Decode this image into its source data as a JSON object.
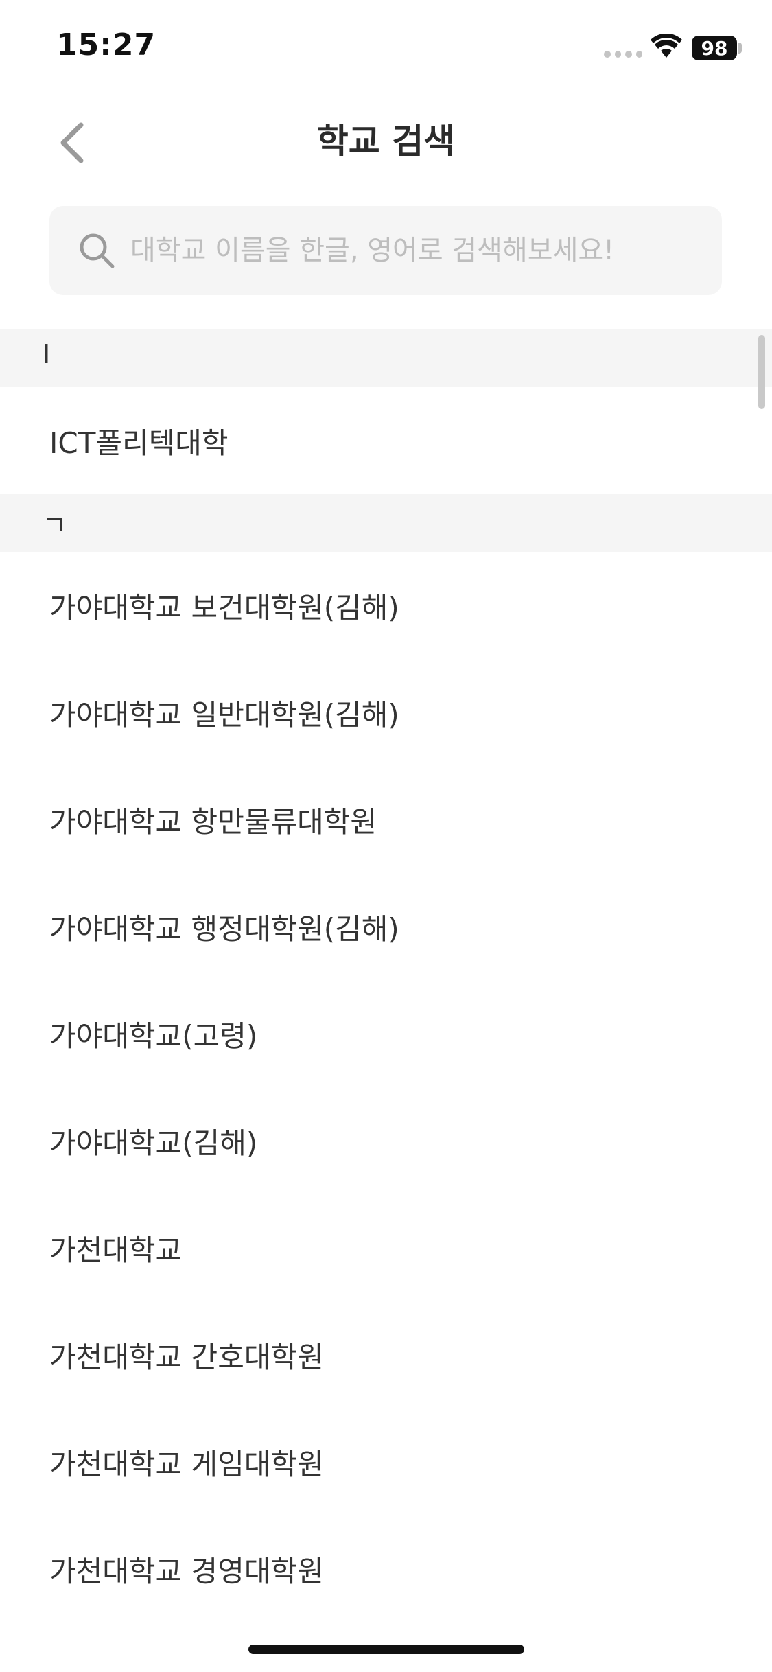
{
  "status_bar": {
    "time": "15:27",
    "battery": "98"
  },
  "header": {
    "title": "학교 검색",
    "back_icon": "chevron-left-icon"
  },
  "search": {
    "placeholder": "대학교 이름을 한글, 영어로 검색해보세요!",
    "value": "",
    "icon": "search-icon"
  },
  "sections": [
    {
      "header": "I",
      "items": [
        "ICT폴리텍대학"
      ]
    },
    {
      "header": "ㄱ",
      "items": [
        "가야대학교 보건대학원(김해)",
        "가야대학교 일반대학원(김해)",
        "가야대학교 항만물류대학원",
        "가야대학교 행정대학원(김해)",
        "가야대학교(고령)",
        "가야대학교(김해)",
        "가천대학교",
        "가천대학교 간호대학원",
        "가천대학교 게임대학원",
        "가천대학교 경영대학원"
      ]
    }
  ]
}
